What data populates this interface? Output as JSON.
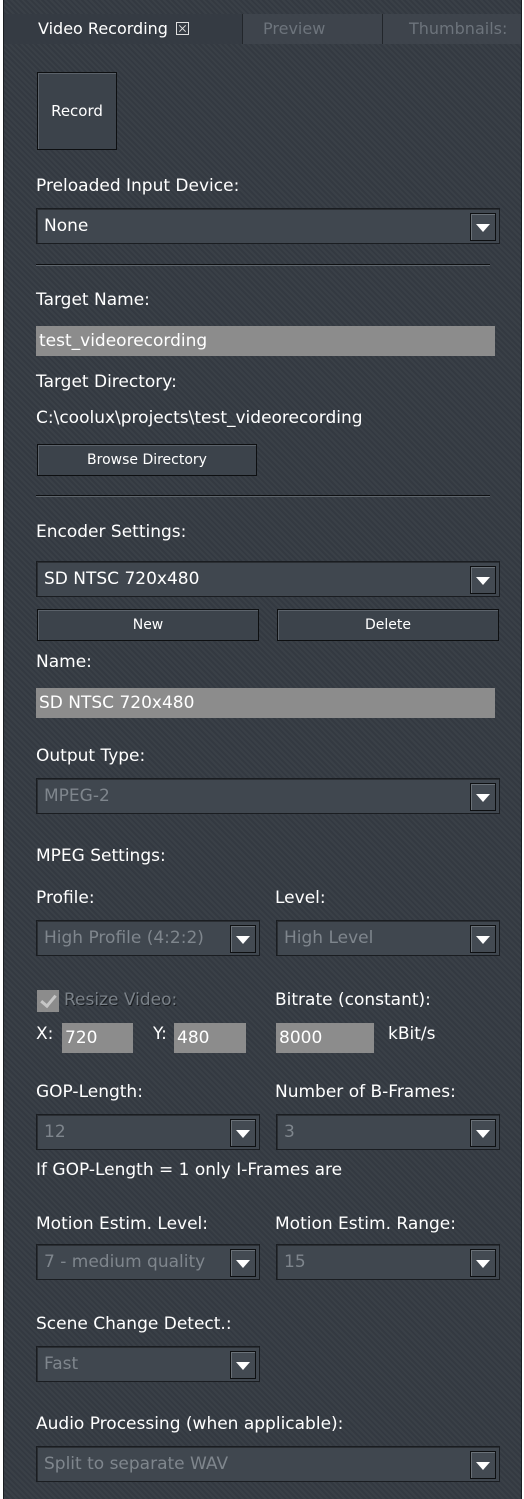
{
  "tabs": [
    {
      "label": "Video Recording"
    },
    {
      "label": "Preview"
    },
    {
      "label": "Thumbnails:"
    }
  ],
  "record_button": "Record",
  "preloaded": {
    "label": "Preloaded Input Device:",
    "value": "None"
  },
  "target": {
    "name_label": "Target Name:",
    "name_value": "test_videorecording",
    "dir_label": "Target Directory:",
    "dir_value": "C:\\coolux\\projects\\test_videorecording",
    "browse": "Browse Directory"
  },
  "encoder": {
    "label": "Encoder Settings:",
    "value": "SD NTSC 720x480",
    "new": "New",
    "delete": "Delete",
    "name_label": "Name:",
    "name_value": "SD NTSC 720x480"
  },
  "output": {
    "label": "Output Type:",
    "value": "MPEG-2"
  },
  "mpeg": {
    "label": "MPEG Settings:",
    "profile_label": "Profile:",
    "profile_value": "High Profile (4:2:2)",
    "level_label": "Level:",
    "level_value": "High Level",
    "resize_label": "Resize Video:",
    "resize_checked": true,
    "x_label": "X:",
    "x_value": "720",
    "y_label": "Y:",
    "y_value": "480",
    "bitrate_label": "Bitrate (constant):",
    "bitrate_value": "8000",
    "bitrate_unit": "kBit/s",
    "gop_label": "GOP-Length:",
    "gop_value": "12",
    "bframes_label": "Number of B-Frames:",
    "bframes_value": "3",
    "gop_note": "If GOP-Length = 1 only I-Frames are",
    "me_level_label": "Motion Estim. Level:",
    "me_level_value": "7 - medium quality",
    "me_range_label": "Motion Estim. Range:",
    "me_range_value": "15",
    "scene_label": "Scene Change Detect.:",
    "scene_value": "Fast",
    "audio_label": "Audio Processing (when applicable):",
    "audio_value": "Split to separate WAV"
  }
}
